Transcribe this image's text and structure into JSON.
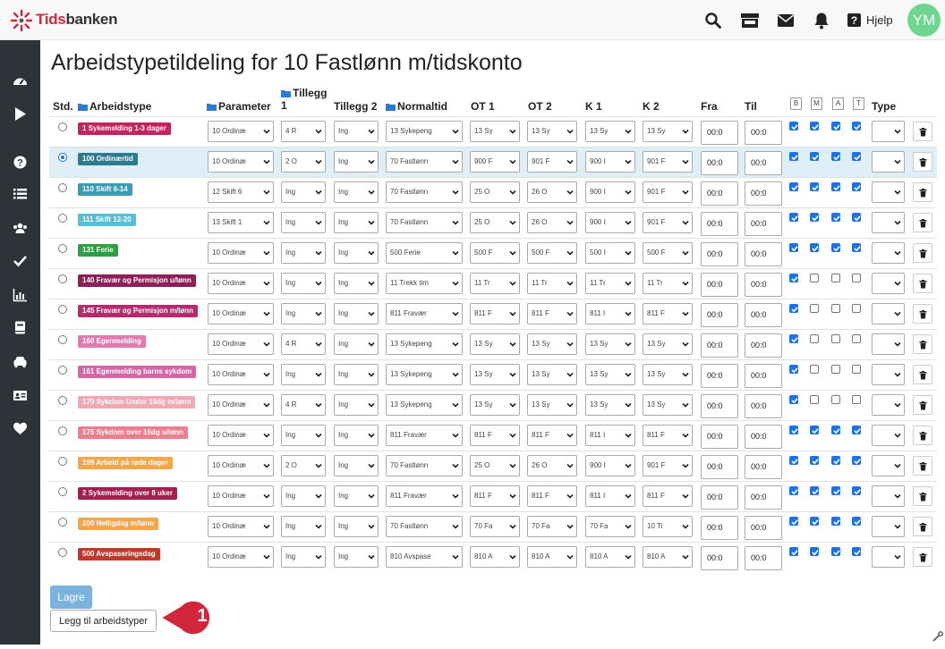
{
  "brand": {
    "part1": "Tids",
    "part2": "banken"
  },
  "header": {
    "help_label": "Hjelp",
    "avatar_initials": "YM"
  },
  "page": {
    "title": "Arbeidstypetildeling for 10 Fastlønn m/tidskonto"
  },
  "columns": {
    "std": "Std.",
    "arbeidstype": "Arbeidstype",
    "parameter": "Parameter",
    "tillegg1_a": "Tillegg",
    "tillegg1_b": "1",
    "tillegg2": "Tillegg 2",
    "normaltid": "Normaltid",
    "ot1": "OT 1",
    "ot2": "OT 2",
    "k1": "K 1",
    "k2": "K 2",
    "fra": "Fra",
    "til": "Til",
    "b": "B",
    "m": "M",
    "a": "A",
    "t": "T",
    "type": "Type"
  },
  "colors": {
    "sidebar": "#2d3338",
    "primary": "#1a73e8",
    "save_button": "#7cb2de",
    "highlight_row": "#dfeff8",
    "callout": "#d1263b"
  },
  "rows": [
    {
      "std": false,
      "badge": "1 Sykemelding 1-3 dager",
      "badge_color": "#c2255c",
      "parameter": "10 Ordinæ",
      "tillegg1": "4 R",
      "tillegg2": "Ing",
      "normaltid": "13 Sykepeng",
      "ot1": "13 Sy",
      "ot2": "13 Sy",
      "k1": "13 Sy",
      "k2": "13 Sy",
      "fra": "00:0",
      "til": "00:0",
      "b": true,
      "m": true,
      "a": true,
      "t": true
    },
    {
      "std": true,
      "badge": "100 Ordinærtid",
      "badge_color": "#2c7b8f",
      "parameter": "10 Ordinæ",
      "tillegg1": "2 O",
      "tillegg2": "Ing",
      "normaltid": "70 Fastlønn",
      "ot1": "900 F",
      "ot2": "901 F",
      "k1": "900 I",
      "k2": "901 F",
      "fra": "00:0",
      "til": "00:0",
      "b": true,
      "m": true,
      "a": true,
      "t": true
    },
    {
      "std": false,
      "badge": "110 Skift 6-14",
      "badge_color": "#3a9cb5",
      "parameter": "12 Skift 6",
      "tillegg1": "Ing",
      "tillegg2": "Ing",
      "normaltid": "70 Fastlønn",
      "ot1": "25 O",
      "ot2": "26 O",
      "k1": "900 I",
      "k2": "901 F",
      "fra": "00:0",
      "til": "00:0",
      "b": true,
      "m": true,
      "a": true,
      "t": true
    },
    {
      "std": false,
      "badge": "111 Skift 12-20",
      "badge_color": "#55bfd8",
      "parameter": "13 Skift 1",
      "tillegg1": "Ing",
      "tillegg2": "Ing",
      "normaltid": "70 Fastlønn",
      "ot1": "25 O",
      "ot2": "26 O",
      "k1": "900 I",
      "k2": "901 F",
      "fra": "00:0",
      "til": "00:0",
      "b": true,
      "m": true,
      "a": true,
      "t": true
    },
    {
      "std": false,
      "badge": "131 Ferie",
      "badge_color": "#2f9e44",
      "parameter": "10 Ordinæ",
      "tillegg1": "Ing",
      "tillegg2": "Ing",
      "normaltid": "500 Ferie",
      "ot1": "500 F",
      "ot2": "500 F",
      "k1": "500 I",
      "k2": "500 F",
      "fra": "00:0",
      "til": "00:0",
      "b": true,
      "m": true,
      "a": true,
      "t": true
    },
    {
      "std": false,
      "badge": "140 Fravær og Permisjon u/lønn",
      "badge_color": "#8e1f57",
      "parameter": "10 Ordinæ",
      "tillegg1": "Ing",
      "tillegg2": "Ing",
      "normaltid": "11 Trekk tim",
      "ot1": "11 Tr",
      "ot2": "11 Tr",
      "k1": "11 Tr",
      "k2": "11 Tr",
      "fra": "00:0",
      "til": "00:0",
      "b": true,
      "m": false,
      "a": false,
      "t": false
    },
    {
      "std": false,
      "badge": "145 Fravær og Permisjon m/lønn",
      "badge_color": "#b52b6d",
      "parameter": "10 Ordinæ",
      "tillegg1": "Ing",
      "tillegg2": "Ing",
      "normaltid": "811 Fravær",
      "ot1": "811 F",
      "ot2": "811 F",
      "k1": "811 I",
      "k2": "811 F",
      "fra": "00:0",
      "til": "00:0",
      "b": true,
      "m": false,
      "a": false,
      "t": false
    },
    {
      "std": false,
      "badge": "160 Egenmelding",
      "badge_color": "#e07bb0",
      "parameter": "10 Ordinæ",
      "tillegg1": "4 R",
      "tillegg2": "Ing",
      "normaltid": "13 Sykepeng",
      "ot1": "13 Sy",
      "ot2": "13 Sy",
      "k1": "13 Sy",
      "k2": "13 Sy",
      "fra": "00:0",
      "til": "00:0",
      "b": true,
      "m": false,
      "a": false,
      "t": false
    },
    {
      "std": false,
      "badge": "161 Egenmelding barns sykdom",
      "badge_color": "#d366a4",
      "parameter": "10 Ordinæ",
      "tillegg1": "Ing",
      "tillegg2": "Ing",
      "normaltid": "13 Sykepeng",
      "ot1": "13 Sy",
      "ot2": "13 Sy",
      "k1": "13 Sy",
      "k2": "13 Sy",
      "fra": "00:0",
      "til": "00:0",
      "b": true,
      "m": false,
      "a": false,
      "t": false
    },
    {
      "std": false,
      "badge": "170 Sykdom Under 16dg m/lønn",
      "badge_color": "#f0a8b3",
      "parameter": "10 Ordinæ",
      "tillegg1": "4 R",
      "tillegg2": "Ing",
      "normaltid": "13 Sykepeng",
      "ot1": "13 Sy",
      "ot2": "13 Sy",
      "k1": "13 Sy",
      "k2": "13 Sy",
      "fra": "00:0",
      "til": "00:0",
      "b": true,
      "m": false,
      "a": false,
      "t": false
    },
    {
      "std": false,
      "badge": "175 Sykdom over 16dg u/lønn",
      "badge_color": "#ec7f8e",
      "parameter": "10 Ordinæ",
      "tillegg1": "Ing",
      "tillegg2": "Ing",
      "normaltid": "811 Fravær",
      "ot1": "811 F",
      "ot2": "811 F",
      "k1": "811 I",
      "k2": "811 F",
      "fra": "00:0",
      "til": "00:0",
      "b": true,
      "m": true,
      "a": true,
      "t": true
    },
    {
      "std": false,
      "badge": "199 Arbeid på røde dager",
      "badge_color": "#f4a64a",
      "parameter": "10 Ordinæ",
      "tillegg1": "2 O",
      "tillegg2": "Ing",
      "normaltid": "70 Fastlønn",
      "ot1": "25 O",
      "ot2": "26 O",
      "k1": "900 I",
      "k2": "901 F",
      "fra": "00:0",
      "til": "00:0",
      "b": true,
      "m": true,
      "a": true,
      "t": true
    },
    {
      "std": false,
      "badge": "2 Sykemelding over 8 uker",
      "badge_color": "#a61e4d",
      "parameter": "10 Ordinæ",
      "tillegg1": "Ing",
      "tillegg2": "Ing",
      "normaltid": "811 Fravær",
      "ot1": "811 F",
      "ot2": "811 F",
      "k1": "811 I",
      "k2": "811 F",
      "fra": "00:0",
      "til": "00:0",
      "b": true,
      "m": true,
      "a": true,
      "t": true
    },
    {
      "std": false,
      "badge": "200 Helligdag m/lønn",
      "badge_color": "#f3a64e",
      "parameter": "10 Ordinæ",
      "tillegg1": "Ing",
      "tillegg2": "Ing",
      "normaltid": "70 Fastlønn",
      "ot1": "70 Fa",
      "ot2": "70 Fa",
      "k1": "70 Fa",
      "k2": "10 Ti",
      "fra": "00:0",
      "til": "00:0",
      "b": true,
      "m": true,
      "a": true,
      "t": true
    },
    {
      "std": false,
      "badge": "500 Avspaseringsdag",
      "badge_color": "#c0392b",
      "parameter": "10 Ordinæ",
      "tillegg1": "Ing",
      "tillegg2": "Ing",
      "normaltid": "810 Avspase",
      "ot1": "810 A",
      "ot2": "810 A",
      "k1": "810 A",
      "k2": "810 A",
      "fra": "00:0",
      "til": "00:0",
      "b": true,
      "m": true,
      "a": true,
      "t": true
    }
  ],
  "actions": {
    "save_label": "Lagre",
    "add_label": "Legg til arbeidstyper"
  },
  "callout": {
    "number": "1"
  }
}
